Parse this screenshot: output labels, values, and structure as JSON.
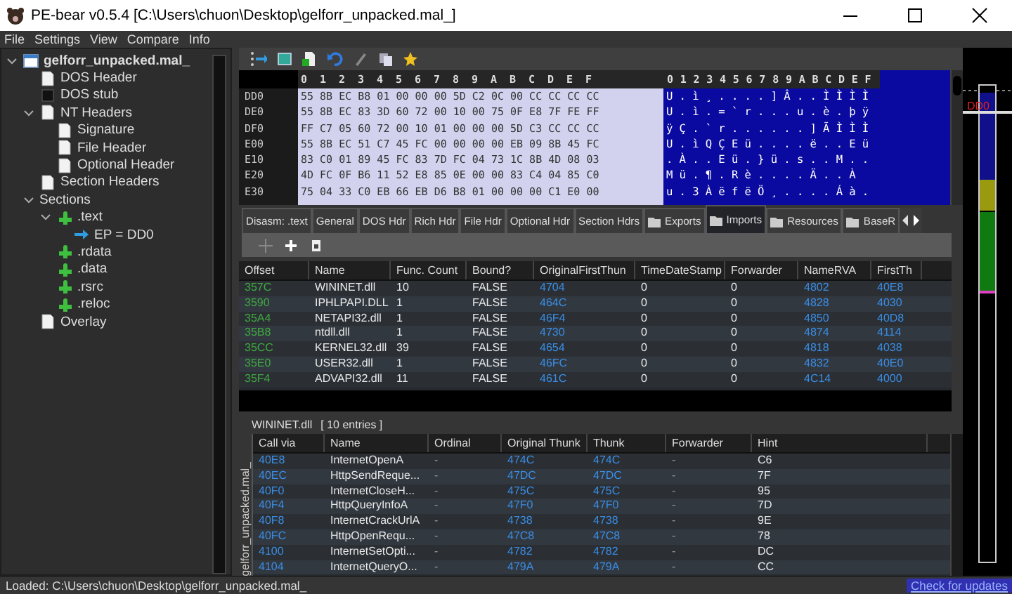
{
  "window": {
    "title": "PE-bear v0.5.4 [C:\\Users\\chuon\\Desktop\\gelforr_unpacked.mal_]"
  },
  "menu": [
    "File",
    "Settings",
    "View",
    "Compare",
    "Info"
  ],
  "tree": {
    "items": [
      {
        "label": "gelforr_unpacked.mal_",
        "kind": "module",
        "expanded": true,
        "children": [
          {
            "label": "DOS Header",
            "kind": "doc"
          },
          {
            "label": "DOS stub",
            "kind": "stub"
          },
          {
            "label": "NT Headers",
            "kind": "doc",
            "expanded": true,
            "children": [
              {
                "label": "Signature",
                "kind": "doc"
              },
              {
                "label": "File Header",
                "kind": "doc"
              },
              {
                "label": "Optional Header",
                "kind": "doc"
              }
            ]
          },
          {
            "label": "Section Headers",
            "kind": "doc"
          },
          {
            "label": "Sections",
            "kind": "group",
            "expanded": true,
            "children": [
              {
                "label": ".text",
                "kind": "section",
                "expanded": true,
                "children": [
                  {
                    "label": "EP = DD0",
                    "kind": "entry"
                  }
                ]
              },
              {
                "label": ".rdata",
                "kind": "section"
              },
              {
                "label": ".data",
                "kind": "section"
              },
              {
                "label": ".rsrc",
                "kind": "section"
              },
              {
                "label": ".reloc",
                "kind": "section"
              }
            ]
          },
          {
            "label": "Overlay",
            "kind": "doc"
          }
        ]
      }
    ]
  },
  "hex_view": {
    "columns": [
      "0",
      "1",
      "2",
      "3",
      "4",
      "5",
      "6",
      "7",
      "8",
      "9",
      "A",
      "B",
      "C",
      "D",
      "E",
      "F"
    ],
    "text_columns": [
      "0",
      "1",
      "2",
      "3",
      "4",
      "5",
      "6",
      "7",
      "8",
      "9",
      "A",
      "B",
      "C",
      "D",
      "E",
      "F"
    ],
    "rows": [
      {
        "address": "DD0",
        "bytes": "55 8B EC B8 01 00 00 00 5D C2 0C 00 CC CC CC CC",
        "text": "U.ì¸....]Â..ÌÌÌÌ"
      },
      {
        "address": "DE0",
        "bytes": "55 8B EC 83 3D 60 72 00 10 00 75 0F E8 7F FE FF",
        "text": "U.ì.=`r...u.è.þÿ"
      },
      {
        "address": "DF0",
        "bytes": "FF C7 05 60 72 00 10 01 00 00 00 5D C3 CC CC CC",
        "text": "ÿÇ.`r......]ÃÌÌÌ"
      },
      {
        "address": "E00",
        "bytes": "55 8B EC 51 C7 45 FC 00 00 00 00 EB 09 8B 45 FC",
        "text": "U.ìQÇEü....ë..Eü"
      },
      {
        "address": "E10",
        "bytes": "83 C0 01 89 45 FC 83 7D FC 04 73 1C 8B 4D 08 03",
        "text": ".À..Eü.}ü.s..M.."
      },
      {
        "address": "E20",
        "bytes": "4D FC 0F B6 11 52 E8 85 0E 00 00 83 C4 04 85 C0",
        "text": "Mü.¶.Rè....Ä..À"
      },
      {
        "address": "E30",
        "bytes": "75 04 33 C0 EB 66 EB D6 B8 01 00 00 00 C1 E0 00",
        "text": "u.3ÀëfëÖ¸....Áà."
      }
    ]
  },
  "map": {
    "label": "DD0"
  },
  "tabs": [
    {
      "label": "Disasm: .text",
      "kind": "plain",
      "selected": false
    },
    {
      "label": "General",
      "kind": "plain",
      "selected": false
    },
    {
      "label": "DOS Hdr",
      "kind": "plain",
      "selected": false
    },
    {
      "label": "Rich Hdr",
      "kind": "plain",
      "selected": false
    },
    {
      "label": "File Hdr",
      "kind": "plain",
      "selected": false
    },
    {
      "label": "Optional Hdr",
      "kind": "plain",
      "selected": false
    },
    {
      "label": "Section Hdrs",
      "kind": "plain",
      "selected": false
    },
    {
      "label": "Exports",
      "kind": "folder",
      "selected": false
    },
    {
      "label": "Imports",
      "kind": "folder",
      "selected": true
    },
    {
      "label": "Resources",
      "kind": "folder",
      "selected": false
    },
    {
      "label": "BaseR",
      "kind": "folder",
      "selected": false
    }
  ],
  "imports": {
    "columns": [
      {
        "label": "Offset",
        "kind": "offset"
      },
      {
        "label": "Name",
        "kind": "text"
      },
      {
        "label": "Func. Count",
        "kind": "text"
      },
      {
        "label": "Bound?",
        "kind": "text"
      },
      {
        "label": "OriginalFirstThun",
        "kind": "rva"
      },
      {
        "label": "TimeDateStamp",
        "kind": "text"
      },
      {
        "label": "Forwarder",
        "kind": "text"
      },
      {
        "label": "NameRVA",
        "kind": "rva"
      },
      {
        "label": "FirstTh",
        "kind": "rva"
      }
    ],
    "rows": [
      [
        "357C",
        "WININET.dll",
        "10",
        "FALSE",
        "4704",
        "0",
        "0",
        "4802",
        "40E8"
      ],
      [
        "3590",
        "IPHLPAPI.DLL",
        "1",
        "FALSE",
        "464C",
        "0",
        "0",
        "4828",
        "4030"
      ],
      [
        "35A4",
        "NETAPI32.dll",
        "1",
        "FALSE",
        "46F4",
        "0",
        "0",
        "4850",
        "40D8"
      ],
      [
        "35B8",
        "ntdll.dll",
        "1",
        "FALSE",
        "4730",
        "0",
        "0",
        "4874",
        "4114"
      ],
      [
        "35CC",
        "KERNEL32.dll",
        "39",
        "FALSE",
        "4654",
        "0",
        "0",
        "4818",
        "4038"
      ],
      [
        "35E0",
        "USER32.dll",
        "1",
        "FALSE",
        "46FC",
        "0",
        "0",
        "4832",
        "40E0"
      ],
      [
        "35F4",
        "ADVAPI32.dll",
        "11",
        "FALSE",
        "461C",
        "0",
        "0",
        "4C14",
        "4000"
      ]
    ]
  },
  "thunks": {
    "title": "WININET.dll",
    "count": "[ 10 entries ]",
    "side_label": "gelforr_unpacked.mal_",
    "columns": [
      {
        "label": "Call via",
        "kind": "rva"
      },
      {
        "label": "Name",
        "kind": "text"
      },
      {
        "label": "Ordinal",
        "kind": "dash"
      },
      {
        "label": "Original Thunk",
        "kind": "rva"
      },
      {
        "label": "Thunk",
        "kind": "rva"
      },
      {
        "label": "Forwarder",
        "kind": "dash"
      },
      {
        "label": "Hint",
        "kind": "text"
      }
    ],
    "rows": [
      [
        "40E8",
        "InternetOpenA",
        "-",
        "474C",
        "474C",
        "-",
        "C6"
      ],
      [
        "40EC",
        "HttpSendReque...",
        "-",
        "47DC",
        "47DC",
        "-",
        "7F"
      ],
      [
        "40F0",
        "InternetCloseH...",
        "-",
        "475C",
        "475C",
        "-",
        "95"
      ],
      [
        "40F4",
        "HttpQueryInfoA",
        "-",
        "47F0",
        "47F0",
        "-",
        "7D"
      ],
      [
        "40F8",
        "InternetCrackUrlA",
        "-",
        "4738",
        "4738",
        "-",
        "9E"
      ],
      [
        "40FC",
        "HttpOpenRequ...",
        "-",
        "47C8",
        "47C8",
        "-",
        "78"
      ],
      [
        "4100",
        "InternetSetOpti...",
        "-",
        "4782",
        "4782",
        "-",
        "DC"
      ],
      [
        "4104",
        "InternetQueryO...",
        "-",
        "479A",
        "479A",
        "-",
        "CC"
      ]
    ]
  },
  "status_bar": {
    "text": "Loaded: C:\\Users\\chuon\\Desktop\\gelforr_unpacked.mal_",
    "link": "Check for updates"
  }
}
